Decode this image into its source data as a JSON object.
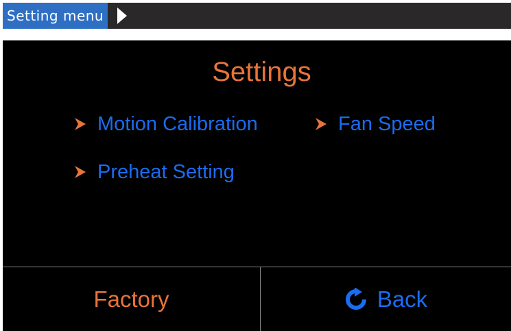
{
  "header": {
    "label": "Setting menu",
    "arrow_icon": "triangle-right-icon"
  },
  "screen": {
    "title": "Settings",
    "menu_items": [
      {
        "label": "Motion Calibration",
        "icon": "chevron-right-icon"
      },
      {
        "label": "Fan Speed",
        "icon": "chevron-right-icon"
      },
      {
        "label": "Preheat Setting",
        "icon": "chevron-right-icon"
      }
    ],
    "buttons": {
      "factory_label": "Factory",
      "back_label": "Back",
      "back_icon": "refresh-icon"
    }
  },
  "colors": {
    "header_bar": "#2a2828",
    "header_label_bg": "#2e6fc4",
    "screen_bg": "#000000",
    "accent_orange": "#e8743a",
    "accent_blue": "#1a6cf0",
    "divider": "#8a8a8a"
  }
}
